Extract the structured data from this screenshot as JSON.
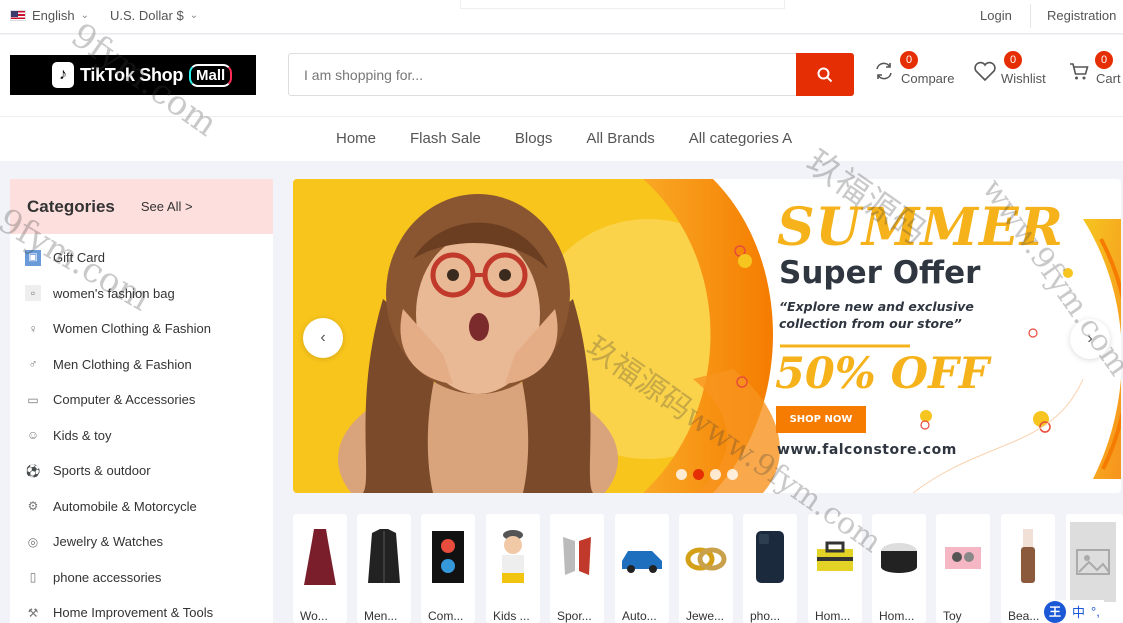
{
  "topbar": {
    "language": "English",
    "currency": "U.S. Dollar $",
    "login": "Login",
    "registration": "Registration"
  },
  "header": {
    "logo_text": "TikTok Shop",
    "logo_badge": "Mall",
    "search_placeholder": "I am shopping for...",
    "compare": {
      "label": "Compare",
      "count": "0"
    },
    "wishlist": {
      "label": "Wishlist",
      "count": "0"
    },
    "cart": {
      "label": "Cart",
      "count": "0"
    }
  },
  "nav": {
    "items": [
      "Home",
      "Flash Sale",
      "Blogs",
      "All Brands",
      "All categories A"
    ]
  },
  "sidebar": {
    "title": "Categories",
    "see_all": "See All >",
    "items": [
      {
        "label": "Gift Card",
        "icon": "gift-card-icon"
      },
      {
        "label": "women's fashion bag",
        "icon": "image-placeholder-icon"
      },
      {
        "label": "Women Clothing & Fashion",
        "icon": "dress-icon"
      },
      {
        "label": "Men Clothing & Fashion",
        "icon": "shirt-icon"
      },
      {
        "label": "Computer & Accessories",
        "icon": "computer-icon"
      },
      {
        "label": "Kids & toy",
        "icon": "toy-icon"
      },
      {
        "label": "Sports & outdoor",
        "icon": "sports-icon"
      },
      {
        "label": "Automobile & Motorcycle",
        "icon": "car-icon"
      },
      {
        "label": "Jewelry & Watches",
        "icon": "watch-icon"
      },
      {
        "label": "phone accessories",
        "icon": "phone-icon"
      },
      {
        "label": "Home Improvement & Tools",
        "icon": "tools-icon"
      }
    ]
  },
  "banner": {
    "headline": "SUMMER",
    "subheadline": "Super Offer",
    "tagline": "“Explore new and exclusive collection from our store”",
    "discount": "50% OFF",
    "cta": "SHOP NOW",
    "url": "www.falconstore.com",
    "active_slide": 2,
    "slide_count": 4
  },
  "products": [
    {
      "name": "Wo...",
      "icon": "dress-thumb"
    },
    {
      "name": "Men...",
      "icon": "jacket-thumb"
    },
    {
      "name": "Com...",
      "icon": "pc-case-thumb"
    },
    {
      "name": "Kids ...",
      "icon": "kid-thumb"
    },
    {
      "name": "Spor...",
      "icon": "gloves-thumb"
    },
    {
      "name": "Auto...",
      "icon": "car-thumb"
    },
    {
      "name": "Jewe...",
      "icon": "rings-thumb"
    },
    {
      "name": "pho...",
      "icon": "phone-thumb"
    },
    {
      "name": "Hom...",
      "icon": "toolbox-thumb"
    },
    {
      "name": "Hom...",
      "icon": "pouf-thumb"
    },
    {
      "name": "Toy",
      "icon": "toy-thumb"
    },
    {
      "name": "Bea...",
      "icon": "lipgloss-thumb"
    },
    {
      "name": "",
      "icon": "image-placeholder-thumb"
    }
  ],
  "ime": {
    "badge": "王",
    "lang": "中"
  },
  "watermarks": [
    "9fym.com",
    "玖福源码",
    "www.9fym.com",
    "玖福源码www.9fym.com",
    "9fym.com"
  ],
  "colors": {
    "accent": "#e62e04",
    "sidebar_head": "#fde0de",
    "banner_orange": "#f7931e",
    "banner_yellow": "#f6c520"
  }
}
